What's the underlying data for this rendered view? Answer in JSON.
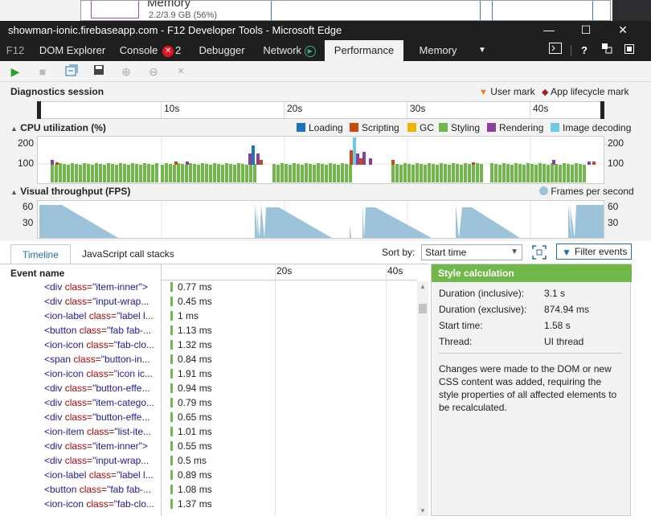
{
  "background_window": {
    "title": "Memory",
    "subtitle": "2.2/3.9 GB (56%)"
  },
  "window": {
    "title": "showman-ionic.firebaseapp.com - F12 Developer Tools - Microsoft Edge",
    "minimize": "—",
    "maximize": "☐",
    "close": "✕"
  },
  "tabs": {
    "f12": "F12",
    "dom": "DOM Explorer",
    "console": "Console",
    "console_errors": "✕",
    "console_count": "2",
    "debugger": "Debugger",
    "network": "Network",
    "network_icon": "▶",
    "performance": "Performance",
    "memory": "Memory",
    "more": "▼"
  },
  "diagnostics": {
    "title": "Diagnostics session",
    "user_mark": "User mark",
    "lifecycle_mark": "App lifecycle mark",
    "ticks": [
      "10s",
      "20s",
      "30s",
      "40s"
    ]
  },
  "cpu": {
    "title": "CPU utilization (%)",
    "y_top": "200",
    "y_mid": "100",
    "legend": [
      "Loading",
      "Scripting",
      "GC",
      "Styling",
      "Rendering",
      "Image decoding"
    ],
    "colors": {
      "loading": "#1e73be",
      "scripting": "#c84a0e",
      "gc": "#f0b400",
      "styling": "#71b84a",
      "rendering": "#8b3e9e",
      "image": "#6cc9e8"
    }
  },
  "fps": {
    "title": "Visual throughput (FPS)",
    "legend": "Frames per second",
    "y_top": "60",
    "y_mid": "30",
    "color": "#9cc3d9"
  },
  "lower": {
    "tab_timeline": "Timeline",
    "tab_js": "JavaScript call stacks",
    "sort_label": "Sort by:",
    "sort_value": "Start time",
    "filter": "Filter events",
    "event_name": "Event name",
    "ruler": [
      "20s",
      "40s"
    ]
  },
  "events": [
    {
      "tag": "<div",
      "attr": "class=",
      "val": "\"item-inner\">",
      "dur": "0.77 ms"
    },
    {
      "tag": "<div",
      "attr": "class=",
      "val": "\"input-wrap...",
      "dur": "0.45 ms"
    },
    {
      "tag": "<ion-label",
      "attr": "class=",
      "val": "\"label l...",
      "dur": "1 ms"
    },
    {
      "tag": "<button",
      "attr": "class=",
      "val": "\"fab fab-...",
      "dur": "1.13 ms"
    },
    {
      "tag": "<ion-icon",
      "attr": "class=",
      "val": "\"fab-clo...",
      "dur": "1.32 ms"
    },
    {
      "tag": "<span",
      "attr": "class=",
      "val": "\"button-in...",
      "dur": "0.84 ms"
    },
    {
      "tag": "<ion-icon",
      "attr": "class=",
      "val": "\"icon ic...",
      "dur": "1.91 ms"
    },
    {
      "tag": "<div",
      "attr": "class=",
      "val": "\"button-effe...",
      "dur": "0.94 ms"
    },
    {
      "tag": "<div",
      "attr": "class=",
      "val": "\"item-catego...",
      "dur": "0.79 ms"
    },
    {
      "tag": "<div",
      "attr": "class=",
      "val": "\"button-effe...",
      "dur": "0.65 ms"
    },
    {
      "tag": "<ion-item",
      "attr": "class=",
      "val": "\"list-ite...",
      "dur": "1.01 ms"
    },
    {
      "tag": "<div",
      "attr": "class=",
      "val": "\"item-inner\">",
      "dur": "0.55 ms"
    },
    {
      "tag": "<div",
      "attr": "class=",
      "val": "\"input-wrap...",
      "dur": "0.5 ms"
    },
    {
      "tag": "<ion-label",
      "attr": "class=",
      "val": "\"label l...",
      "dur": "0.89 ms"
    },
    {
      "tag": "<button",
      "attr": "class=",
      "val": "\"fab fab-...",
      "dur": "1.08 ms"
    },
    {
      "tag": "<ion-icon",
      "attr": "class=",
      "val": "\"fab-clo...",
      "dur": "1.37 ms"
    }
  ],
  "details": {
    "title": "Style calculation",
    "rows": [
      {
        "label": "Duration (inclusive):",
        "value": "3.1 s"
      },
      {
        "label": "Duration (exclusive):",
        "value": "874.94 ms"
      },
      {
        "label": "Start time:",
        "value": "1.58 s"
      },
      {
        "label": "Thread:",
        "value": "UI thread"
      }
    ],
    "description": "Changes were made to the DOM or new CSS content was added, requiring the style properties of all affected elements to be recalculated."
  }
}
